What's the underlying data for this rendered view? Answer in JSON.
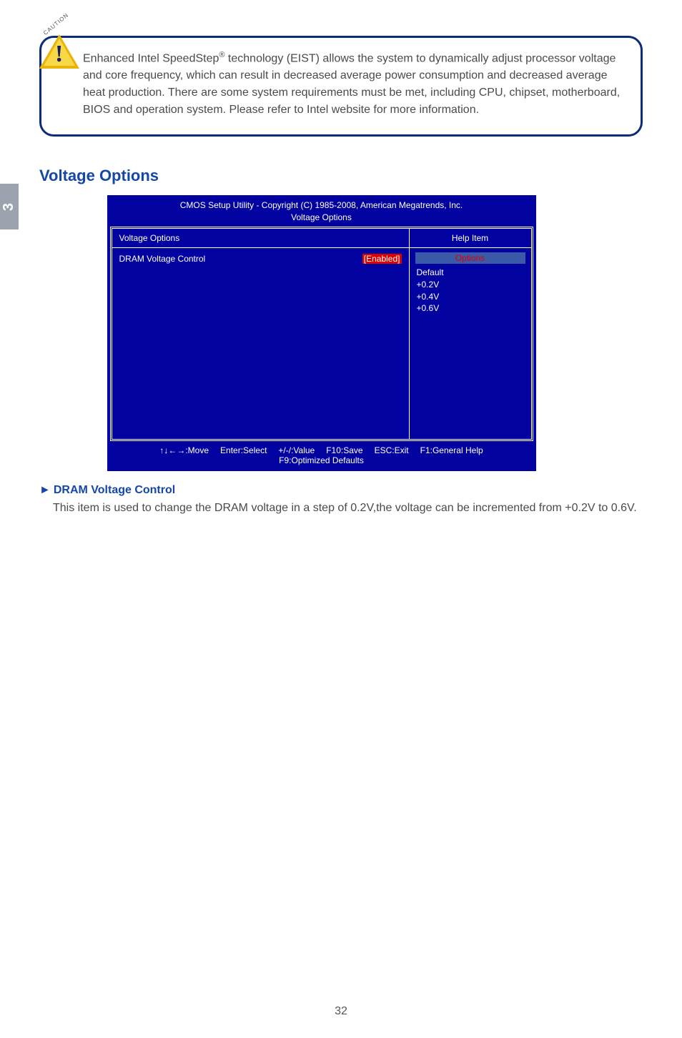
{
  "caution": {
    "badge_label": "CAUTION",
    "excl": "!",
    "text_part1": "Enhanced Intel SpeedStep",
    "reg": "®",
    "text_part2": " technology (EIST) allows the system to dynamically adjust processor voltage and core frequency, which can result in decreased average power consumption and decreased average heat production.  There are some system requirements must be met, including CPU, chipset, motherboard, BIOS and operation system. Please refer to Intel website for more information."
  },
  "chapter_tab": "3",
  "section_title": "Voltage Options",
  "bios": {
    "header_line1": "CMOS Setup Utility - Copyright (C) 1985-2008, American Megatrends, Inc.",
    "header_line2": "Voltage Options",
    "left_title": "Voltage Options",
    "option_label": "DRAM Voltage Control",
    "option_value": "[Enabled]",
    "help_title": "Help Item",
    "options_title": "Options",
    "options_list": [
      "Default",
      "+0.2V",
      "+0.4V",
      "+0.6V"
    ],
    "footer_move": "↑↓←→:Move",
    "footer_select": "Enter:Select",
    "footer_value": "+/-/:Value",
    "footer_save": "F10:Save",
    "footer_exit": "ESC:Exit",
    "footer_help": "F1:General Help",
    "footer_defaults": "F9:Optimized Defaults"
  },
  "subhead": {
    "arrow": "►",
    "text": "DRAM Voltage Control"
  },
  "body_text": "This item is used to change the DRAM voltage in a step of 0.2V,the voltage can be incremented from +0.2V to 0.6V.",
  "page_number": "32"
}
